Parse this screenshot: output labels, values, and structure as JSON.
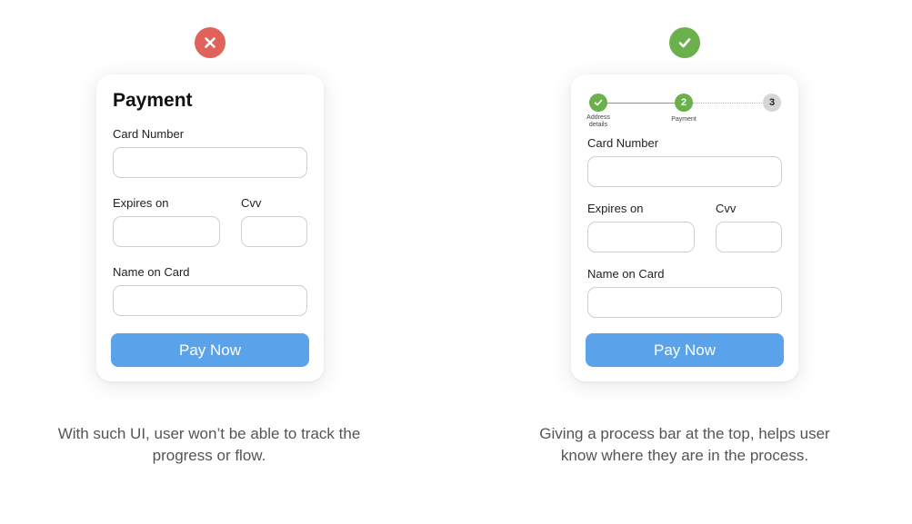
{
  "left": {
    "title": "Payment",
    "card_number_label": "Card Number",
    "expires_label": "Expires on",
    "cvv_label": "Cvv",
    "name_label": "Name on Card",
    "button_label": "Pay Now",
    "caption_line1": "With such UI, user won’t be able to track the",
    "caption_line2": "progress or flow."
  },
  "right": {
    "steps": [
      {
        "number": "",
        "label_line1": "Address",
        "label_line2": "details",
        "status": "complete"
      },
      {
        "number": "2",
        "label_line1": "Payment",
        "label_line2": "",
        "status": "current"
      },
      {
        "number": "3",
        "label_line1": "",
        "label_line2": "",
        "status": "upcoming"
      }
    ],
    "card_number_label": "Card Number",
    "expires_label": "Expires on",
    "cvv_label": "Cvv",
    "name_label": "Name on Card",
    "button_label": "Pay Now",
    "caption_line1": "Giving a process bar at the top, helps user",
    "caption_line2": "know where they are in the process."
  },
  "colors": {
    "bad": "#e0625a",
    "good": "#6ab04c",
    "button": "#5aa3ea",
    "step_upcoming": "#d6d6d6"
  },
  "icons": {
    "bad_badge": "close-icon",
    "good_badge": "check-icon",
    "step_complete": "check-icon"
  }
}
